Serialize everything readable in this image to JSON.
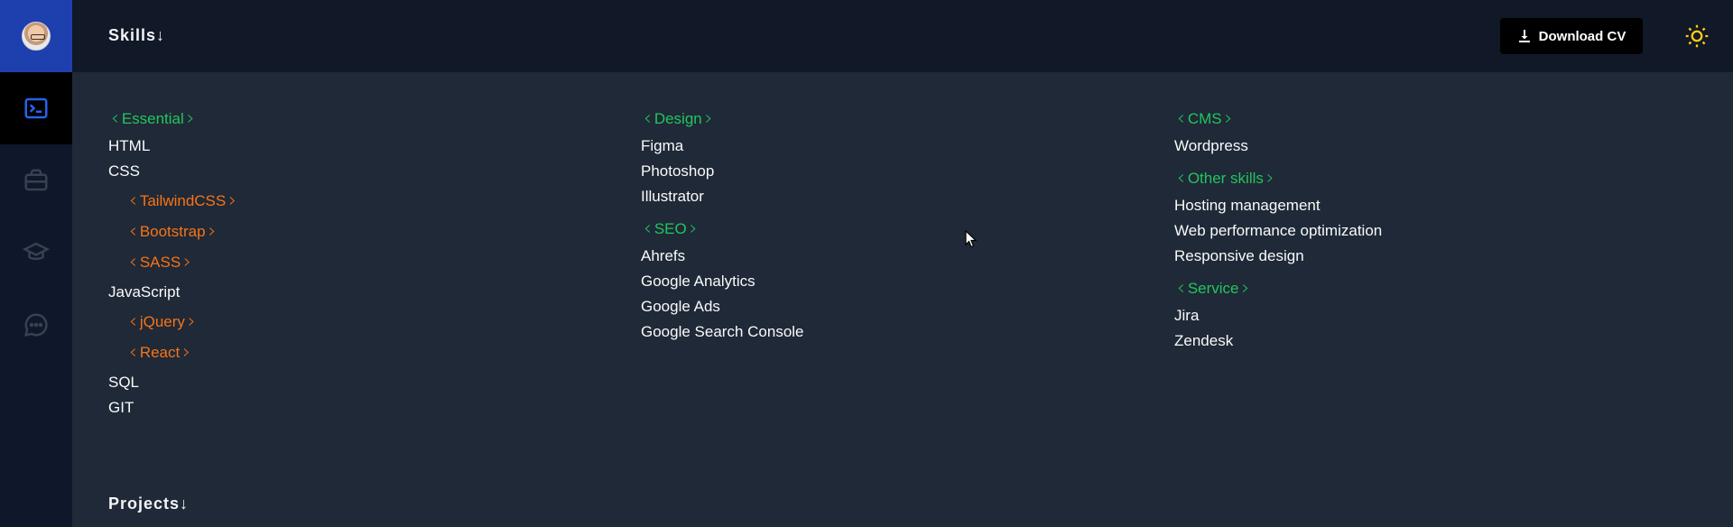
{
  "header": {
    "section_title": "Skills↓",
    "download_label": "Download CV",
    "download_icon": "download-icon",
    "theme_icon": "sun-icon"
  },
  "sidebar": {
    "avatar": "avatar",
    "items": [
      {
        "icon": "terminal-icon",
        "active": true
      },
      {
        "icon": "briefcase-icon",
        "active": false
      },
      {
        "icon": "graduation-cap-icon",
        "active": false
      },
      {
        "icon": "chat-icon",
        "active": false
      }
    ]
  },
  "skills": {
    "col1": {
      "essential": "Essential",
      "html": "HTML",
      "css": "CSS",
      "tailwind": "TailwindCSS",
      "bootstrap": "Bootstrap",
      "sass": "SASS",
      "javascript": "JavaScript",
      "jquery": "jQuery",
      "react": "React",
      "sql": "SQL",
      "git": "GIT"
    },
    "col2": {
      "design": "Design",
      "figma": "Figma",
      "photoshop": "Photoshop",
      "illustrator": "Illustrator",
      "seo": "SEO",
      "ahrefs": "Ahrefs",
      "analytics": "Google Analytics",
      "ads": "Google Ads",
      "console": "Google Search Console"
    },
    "col3": {
      "cms": "CMS",
      "wordpress": "Wordpress",
      "other": "Other skills",
      "hosting": "Hosting management",
      "webperf": "Web performance optimization",
      "responsive": "Responsive design",
      "service": "Service",
      "jira": "Jira",
      "zendesk": "Zendesk"
    }
  },
  "projects": {
    "section_title": "Projects↓"
  },
  "colors": {
    "accent_green": "#22c55e",
    "accent_orange": "#f97316",
    "active_blue": "#1e40af",
    "sun_yellow": "#facc15"
  }
}
